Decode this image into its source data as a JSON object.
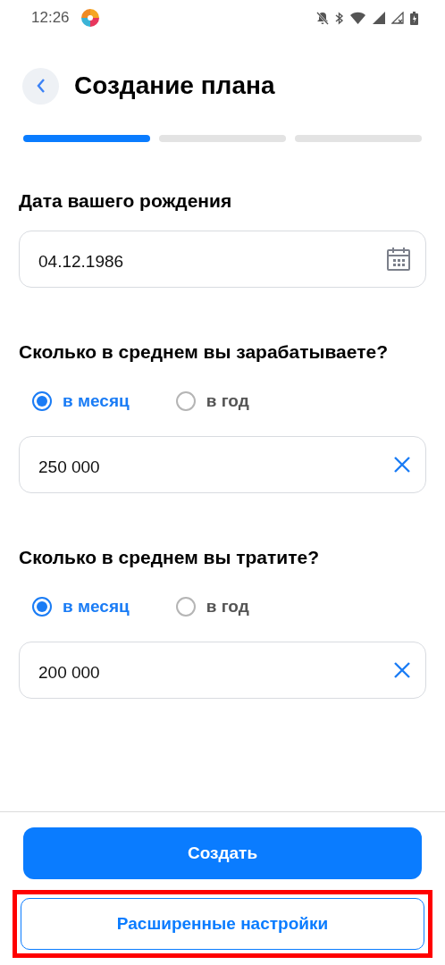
{
  "status_bar": {
    "time": "12:26"
  },
  "header": {
    "title": "Создание плана"
  },
  "progress_steps": [
    {
      "active": true
    },
    {
      "active": false
    },
    {
      "active": false
    }
  ],
  "sections": [
    {
      "kind": "date",
      "label": "Дата вашего рождения",
      "value": "04.12.1986"
    },
    {
      "kind": "amount",
      "label": "Сколько в среднем вы зарабатываете?",
      "options": [
        {
          "label": "в месяц",
          "selected": true
        },
        {
          "label": "в год",
          "selected": false
        }
      ],
      "value": "250 000"
    },
    {
      "kind": "amount",
      "label": "Сколько в среднем вы тратите?",
      "options": [
        {
          "label": "в месяц",
          "selected": true
        },
        {
          "label": "в год",
          "selected": false
        }
      ],
      "value": "200 000"
    }
  ],
  "buttons": {
    "primary": "Создать",
    "secondary": "Расширенные настройки"
  }
}
